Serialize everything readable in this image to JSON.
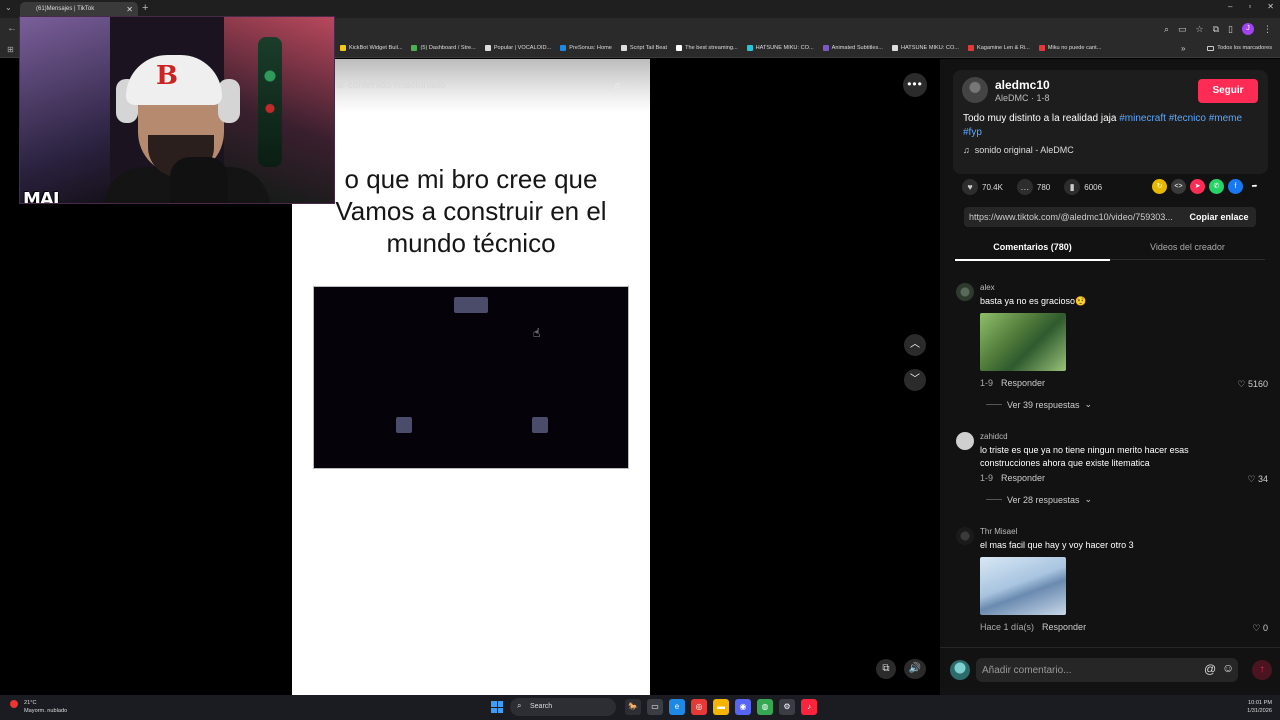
{
  "browser": {
    "tab_title": "(61)Mensajes | TikTok",
    "bookmarks": [
      {
        "label": "KickBot Widget Buil...",
        "color": "#f5c518"
      },
      {
        "label": "(5) Dashboard / Stre...",
        "color": "#4caf50"
      },
      {
        "label": "Popular | VOCALOID...",
        "color": "#dddddd"
      },
      {
        "label": "PreSonus: Home",
        "color": "#1e88e5"
      },
      {
        "label": "Script Tail Beat",
        "color": "#dddddd"
      },
      {
        "label": "The best streaming...",
        "color": "#ffffff"
      },
      {
        "label": "HATSUNE MIKU: CO...",
        "color": "#26c6da"
      },
      {
        "label": "Animated Subtitles...",
        "color": "#7e57c2"
      },
      {
        "label": "HATSUNE MIKU: CO...",
        "color": "#dddddd"
      },
      {
        "label": "Kagamine Len & Ri...",
        "color": "#e53935"
      },
      {
        "label": "Miku no puede cant...",
        "color": "#e53935"
      }
    ],
    "all_bookmarks": "Todos los marcadores",
    "profile_initial": "J"
  },
  "video": {
    "search_placeholder": "ar contenido relacionado",
    "caption_lines": [
      "o que mi bro cree que",
      "Vamos a construir en el",
      "mundo técnico"
    ]
  },
  "webcam": {
    "overlay_text": "MAI"
  },
  "post": {
    "author": "aledmc10",
    "author_meta": "AleDMC · 1-8",
    "follow_label": "Seguir",
    "description_text": "Todo muy distinto a la realidad jaja",
    "hashtags": [
      "#minecraft",
      "#tecnico",
      "#meme",
      "#fyp"
    ],
    "sound": "sonido original - AleDMC",
    "likes": "70.4K",
    "comments": "780",
    "saves": "6006",
    "link": "https://www.tiktok.com/@aledmc10/video/759303...",
    "copy_label": "Copiar enlace",
    "share_colors": [
      "#e6b800",
      "#3a3a3a",
      "#fe2c55",
      "#25d366",
      "#1877f2"
    ]
  },
  "tabs": {
    "comments": "Comentarios (780)",
    "creator": "Videos del creador"
  },
  "comments": [
    {
      "user": "alex",
      "text": "basta ya no es gracioso🤨",
      "date": "1-9",
      "reply": "Responder",
      "likes": "5160",
      "replies": "Ver 39 respuestas"
    },
    {
      "user": "zahidcd",
      "text": "lo triste es que ya no tiene ningun merito hacer esas construcciones ahora que existe litematica",
      "date": "1-9",
      "reply": "Responder",
      "likes": "34",
      "replies": "Ver 28 respuestas"
    },
    {
      "user": "Thr Misael",
      "text": "el mas facil que hay y voy hacer otro 3",
      "date": "Hace 1 día(s)",
      "reply": "Responder",
      "likes": "0"
    }
  ],
  "composer": {
    "placeholder": "Añadir comentario..."
  },
  "taskbar": {
    "temp": "21°C",
    "weather": "Mayorm. nublado",
    "search": "Search",
    "time": "10:01 PM",
    "date": "1/31/2026"
  }
}
